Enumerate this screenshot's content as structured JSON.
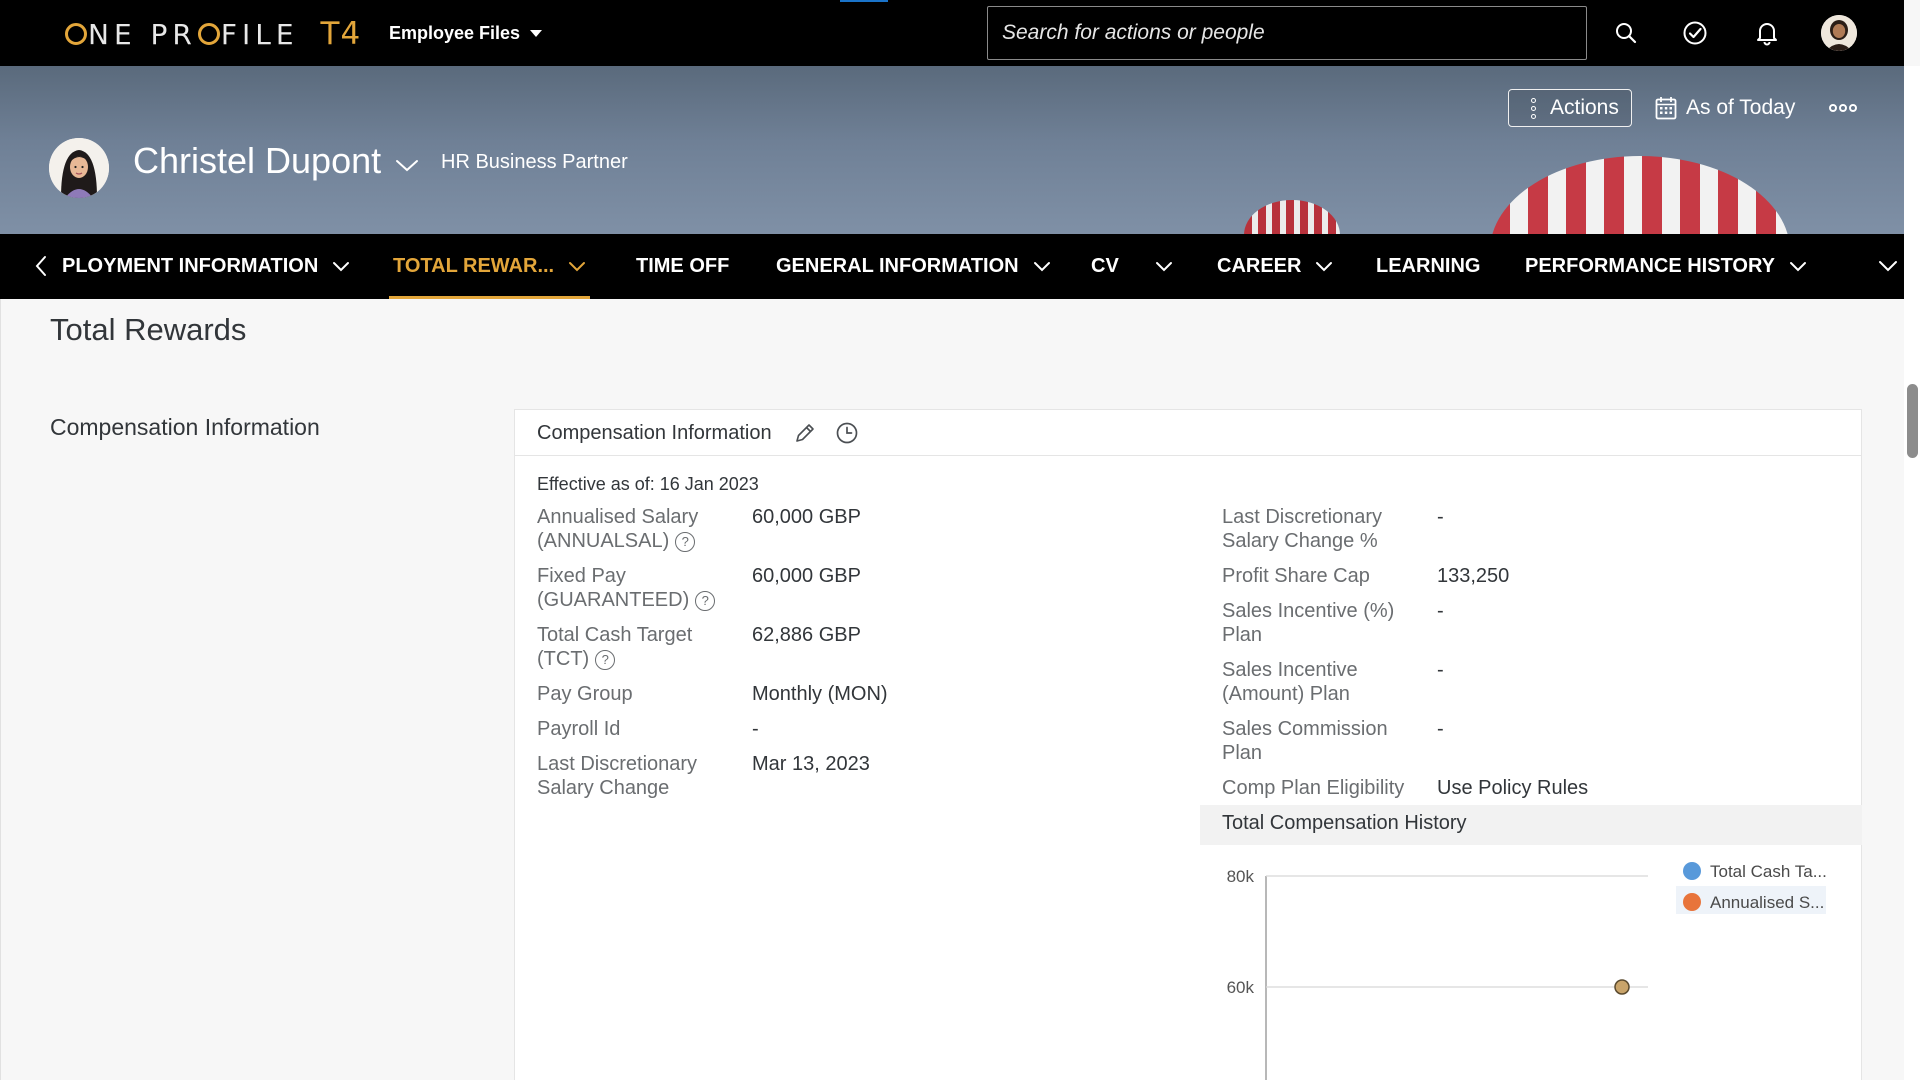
{
  "shell": {
    "logo_text": "ONE PROFILE",
    "logo_suffix": "T4",
    "menu_label": "Employee Files",
    "search_placeholder": "Search for actions or people",
    "icons": [
      "search-icon",
      "check-circle-icon",
      "bell-icon",
      "user-avatar"
    ]
  },
  "header": {
    "employee_name": "Christel Dupont",
    "job_title": "HR Business Partner",
    "actions_label": "Actions",
    "as_of_label": "As of Today"
  },
  "tabs": [
    {
      "label": "PLOYMENT INFORMATION",
      "dropdown": true
    },
    {
      "label": "TOTAL REWAR...",
      "dropdown": true,
      "active": true
    },
    {
      "label": "TIME OFF",
      "dropdown": false
    },
    {
      "label": "GENERAL INFORMATION",
      "dropdown": true
    },
    {
      "label": "CV",
      "dropdown": true
    },
    {
      "label": "CAREER",
      "dropdown": true
    },
    {
      "label": "LEARNING",
      "dropdown": false
    },
    {
      "label": "PERFORMANCE HISTORY",
      "dropdown": true
    }
  ],
  "content": {
    "section_title": "Total Rewards",
    "subsection_title": "Compensation Information",
    "card": {
      "title": "Compensation Information",
      "effective": "Effective as of: 16 Jan 2023",
      "left_fields": [
        {
          "label": "Annualised Salary (ANNUALSAL)",
          "value": "60,000 GBP",
          "help": true
        },
        {
          "label": "Fixed Pay (GUARANTEED)",
          "value": "60,000 GBP",
          "help": true
        },
        {
          "label": "Total Cash Target (TCT)",
          "value": "62,886 GBP",
          "help": true
        },
        {
          "label": "Pay Group",
          "value": "Monthly (MON)",
          "help": false
        },
        {
          "label": "Payroll Id",
          "value": "-",
          "help": false
        },
        {
          "label": "Last Discretionary Salary Change",
          "value": "Mar 13, 2023",
          "help": false
        }
      ],
      "right_fields": [
        {
          "label": "Last Discretionary Salary Change %",
          "value": "-"
        },
        {
          "label": "Profit Share Cap",
          "value": "133,250"
        },
        {
          "label": "Sales Incentive (%) Plan",
          "value": "-"
        },
        {
          "label": "Sales Incentive (Amount) Plan",
          "value": "-"
        },
        {
          "label": "Sales Commission Plan",
          "value": "-"
        },
        {
          "label": "Comp Plan Eligibility",
          "value": "Use Policy Rules"
        }
      ],
      "chart_title": "Total Compensation History"
    }
  },
  "chart_data": {
    "type": "scatter",
    "title": "Total Compensation History",
    "y_ticks": [
      "80k",
      "60k"
    ],
    "ylim": [
      40000,
      80000
    ],
    "series": [
      {
        "name": "Total Cash Ta...",
        "color": "#5899da",
        "values": [
          62886
        ]
      },
      {
        "name": "Annualised S...",
        "color": "#e8743b",
        "values": [
          60000
        ]
      }
    ],
    "marker_color": "#c9a46a",
    "legend": "right"
  }
}
